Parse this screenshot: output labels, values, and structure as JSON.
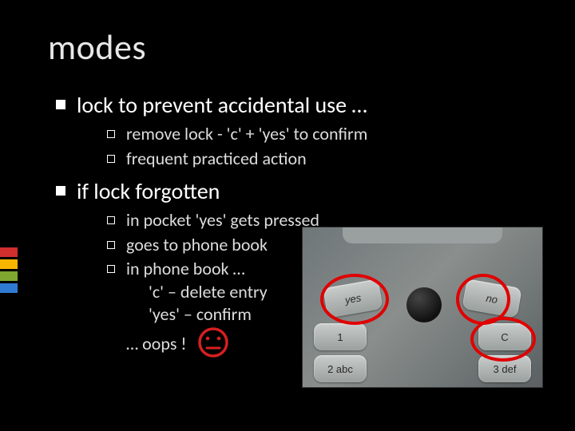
{
  "title": "modes",
  "bullets": {
    "b1": "lock to prevent accidental use …",
    "b1_1": "remove lock - 'c' + 'yes' to confirm",
    "b1_2": "frequent practiced action",
    "b2": "if lock forgotten",
    "b2_1": "in pocket 'yes' gets pressed",
    "b2_2": "goes to phone book",
    "b2_3": "in phone book …",
    "b2_3a": "'c' – delete entry",
    "b2_3b": "'yes' – confirm",
    "b2_3c": "… oops !"
  },
  "phone": {
    "yes": "yes",
    "no": "no",
    "c": "C",
    "k1": "1",
    "k2": "2 abc",
    "k3": "3 def"
  },
  "accent_colors": [
    "#d12e2e",
    "#f7b500",
    "#7fa62f",
    "#2e7bd1"
  ]
}
